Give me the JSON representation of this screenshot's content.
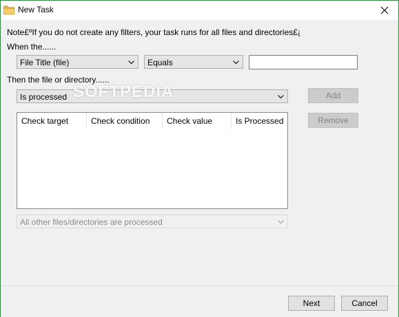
{
  "window": {
    "title": "New Task",
    "accent": "#2d8a3e"
  },
  "note": "Note£ºIf you do not create any filters, your task runs for all files and directories£¡",
  "when_label": "When the......",
  "then_label": "Then the file or directory......",
  "filter": {
    "target": "File Title (file)",
    "condition": "Equals",
    "value": ""
  },
  "action": {
    "selected": "Is processed"
  },
  "buttons": {
    "add": "Add",
    "remove": "Remove",
    "next": "Next",
    "cancel": "Cancel"
  },
  "table": {
    "columns": [
      "Check target",
      "Check condition",
      "Check value",
      "Is Processed"
    ],
    "rows": []
  },
  "others": {
    "selected": "All other files/directories are processed"
  },
  "watermark": "SOFTPEDIA",
  "icons": {
    "title": "folder-icon",
    "close": "close-icon",
    "dropdown": "chevron-down-icon"
  }
}
